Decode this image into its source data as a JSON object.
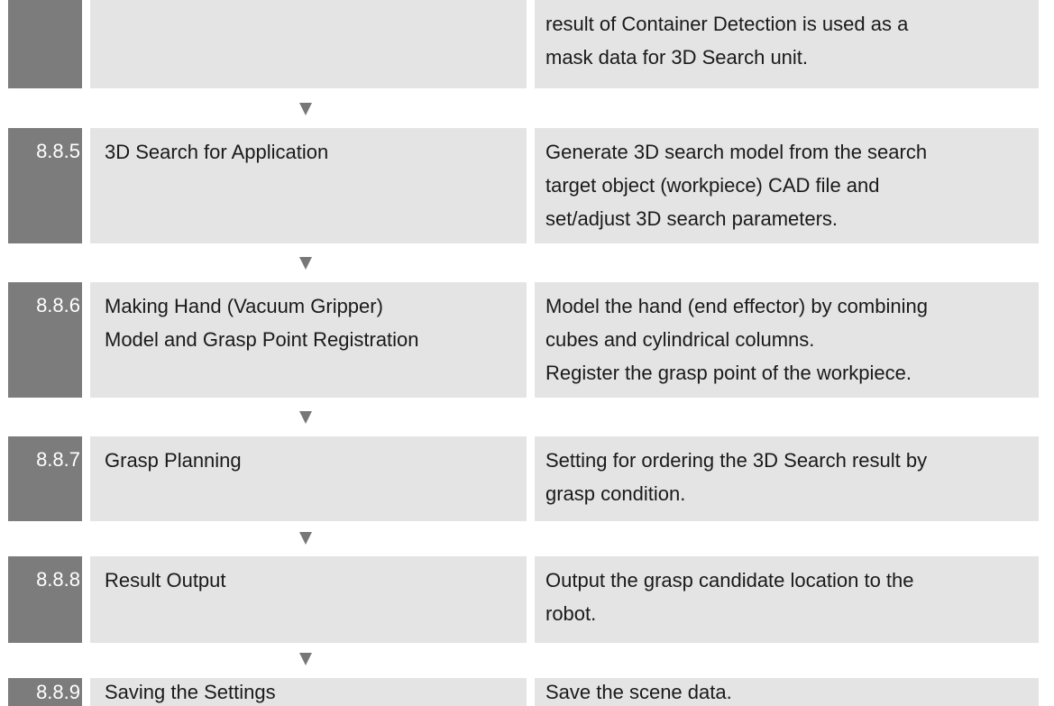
{
  "rows": [
    {
      "number": "",
      "title": [],
      "description": [
        "result of Container Detection is used as a",
        "mask data for 3D Search unit."
      ]
    },
    {
      "number": "8.8.5",
      "title": [
        "3D Search for Application"
      ],
      "description": [
        "Generate 3D search model from the search",
        "target object (workpiece) CAD file and",
        "set/adjust 3D search parameters."
      ]
    },
    {
      "number": "8.8.6",
      "title": [
        "Making Hand (Vacuum Gripper)",
        "Model and Grasp Point Registration"
      ],
      "description": [
        "Model the hand (end effector) by combining",
        "cubes and cylindrical columns.",
        "Register the grasp point of the workpiece."
      ]
    },
    {
      "number": "8.8.7",
      "title": [
        "Grasp Planning"
      ],
      "description": [
        "Setting for ordering the 3D Search result by",
        "grasp condition."
      ]
    },
    {
      "number": "8.8.8",
      "title": [
        "Result Output"
      ],
      "description": [
        "Output the grasp candidate location to the",
        "robot."
      ]
    },
    {
      "number": "8.8.9",
      "title": [
        "Saving the Settings"
      ],
      "description": [
        "Save the scene data."
      ]
    }
  ],
  "colors": {
    "number_cell_bg": "#7c7c7c",
    "content_cell_bg": "#e4e4e4",
    "arrow": "#777777"
  },
  "icons": {
    "flow_arrow": "down-triangle-icon"
  }
}
